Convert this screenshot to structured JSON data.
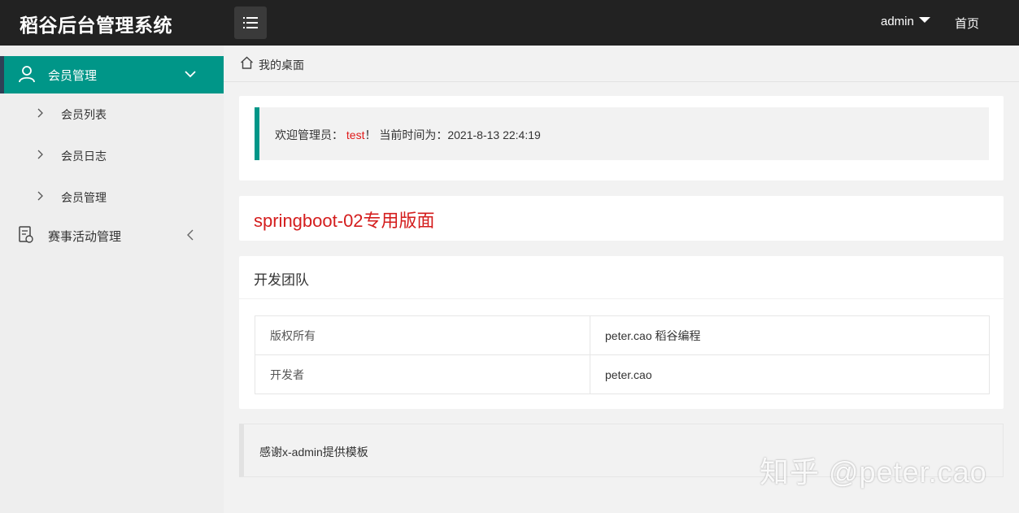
{
  "header": {
    "logo": "稻谷后台管理系统",
    "user": "admin",
    "home": "首页"
  },
  "sidebar": {
    "groups": [
      {
        "label": "会员管理",
        "expanded": true,
        "icon": "user-icon",
        "items": [
          {
            "label": "会员列表"
          },
          {
            "label": "会员日志"
          },
          {
            "label": "会员管理"
          }
        ]
      },
      {
        "label": "赛事活动管理",
        "expanded": false,
        "icon": "document-icon"
      }
    ]
  },
  "breadcrumb": {
    "label": "我的桌面"
  },
  "welcome": {
    "prefix": "欢迎管理员：",
    "username": "test",
    "suffix": "！ 当前时间为：2021-8-13 22:4:19"
  },
  "banner": {
    "title": "springboot-02专用版面"
  },
  "team": {
    "title": "开发团队",
    "rows": [
      {
        "key": "版权所有",
        "value": "peter.cao 稻谷编程"
      },
      {
        "key": "开发者",
        "value": "peter.cao"
      }
    ]
  },
  "footer": {
    "thanks": "感谢x-admin提供模板"
  },
  "watermark": "知乎 @peter.cao",
  "colors": {
    "accent": "#009688",
    "header": "#222222",
    "highlight": "#e01a1a"
  }
}
